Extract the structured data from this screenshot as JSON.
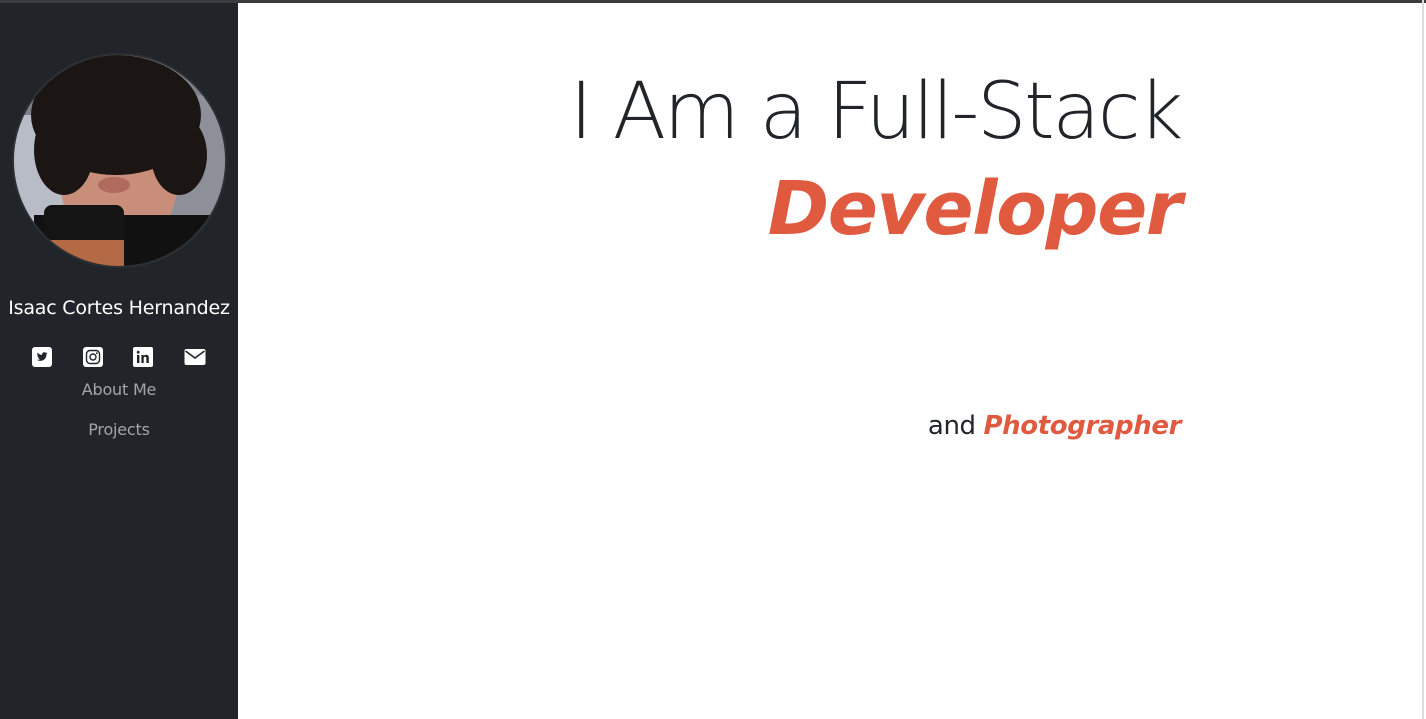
{
  "sidebar": {
    "name": "Isaac Cortes Hernandez",
    "socials": [
      {
        "icon": "twitter-icon"
      },
      {
        "icon": "instagram-icon"
      },
      {
        "icon": "linkedin-icon"
      },
      {
        "icon": "email-icon"
      }
    ],
    "nav": [
      {
        "label": "About Me"
      },
      {
        "label": "Projects"
      }
    ]
  },
  "hero": {
    "headline": "I Am a Full-Stack",
    "headline_accent": "Developer",
    "sub_prefix": "and",
    "sub_accent": "Photographer"
  },
  "colors": {
    "accent": "#e05a40",
    "sidebar_bg": "#212529",
    "text": "#212529",
    "nav_text": "#a2a6ab"
  }
}
